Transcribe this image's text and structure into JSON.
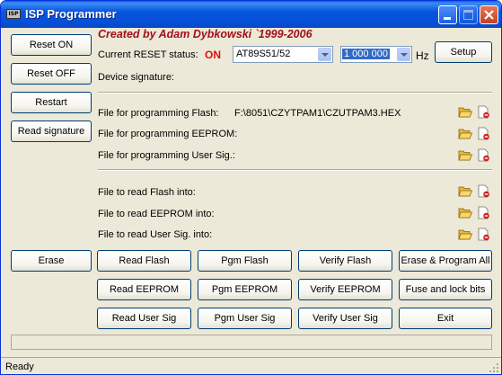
{
  "window": {
    "title": "ISP Programmer",
    "app_icon_text": "ISP"
  },
  "credit": "Created by Adam Dybkowski `1999-2006",
  "left_buttons": {
    "reset_on": "Reset ON",
    "reset_off": "Reset OFF",
    "restart": "Restart",
    "read_signature": "Read signature",
    "erase": "Erase"
  },
  "status": {
    "reset_label": "Current RESET status:",
    "reset_value": "ON",
    "device_select": "AT89S51/52",
    "frequency": "1 000 000",
    "frequency_unit": "Hz",
    "setup": "Setup",
    "device_signature_label": "Device signature:",
    "device_signature_value": ""
  },
  "files": {
    "prog_flash_label": "File for programming Flash:",
    "prog_flash_path": "F:\\8051\\CZYTPAM1\\CZUTPAM3.HEX",
    "prog_eeprom_label": "File for programming EEPROM:",
    "prog_usersig_label": "File for programming User Sig.:",
    "read_flash_label": "File to read Flash into:",
    "read_eeprom_label": "File to read EEPROM into:",
    "read_usersig_label": "File to read User Sig. into:"
  },
  "action_buttons": {
    "read_flash": "Read Flash",
    "pgm_flash": "Pgm Flash",
    "verify_flash": "Verify Flash",
    "erase_program_all": "Erase & Program All",
    "read_eeprom": "Read EEPROM",
    "pgm_eeprom": "Pgm EEPROM",
    "verify_eeprom": "Verify EEPROM",
    "fuse_lock_bits": "Fuse and lock bits",
    "read_user_sig": "Read User Sig",
    "pgm_user_sig": "Pgm User Sig",
    "verify_user_sig": "Verify User Sig",
    "exit": "Exit"
  },
  "statusbar": {
    "text": "Ready"
  },
  "progress": {
    "value": 0
  },
  "icons": {
    "open": "folder-open-icon",
    "clear": "clear-file-icon"
  },
  "colors": {
    "titlebar": "#0855dd",
    "credit": "#a0101a",
    "on_status": "#e01010"
  }
}
